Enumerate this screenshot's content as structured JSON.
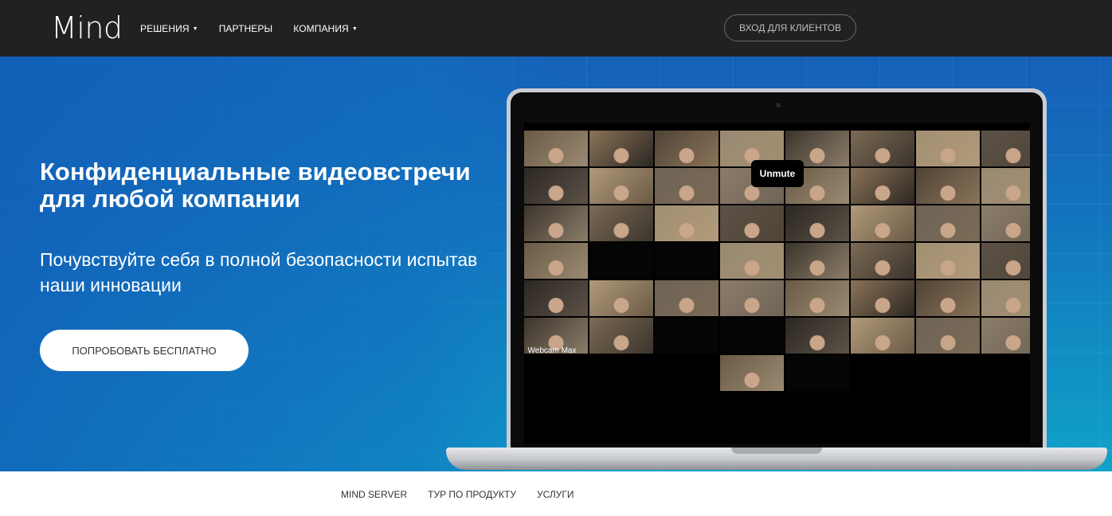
{
  "header": {
    "logo": "Mind",
    "nav": [
      {
        "label": "РЕШЕНИЯ",
        "dropdown": true
      },
      {
        "label": "ПАРТНЕРЫ",
        "dropdown": false
      },
      {
        "label": "КОМПАНИЯ",
        "dropdown": true
      }
    ],
    "login_label": "ВХОД ДЛЯ КЛИЕНТОВ"
  },
  "hero": {
    "headline_bold": "Конфиденциальные",
    "headline_rest": " видеовстречи для любой компании",
    "subline": "Почувствуйте себя в полной безопасности испытав наши инновации",
    "cta_label": "ПОПРОБОВАТЬ БЕСПЛАТНО"
  },
  "video_call": {
    "unmute_label": "Unmute",
    "webcam_label": "Webcam Max"
  },
  "subnav": {
    "links": [
      "MIND SERVER",
      "ТУР ПО ПРОДУКТУ",
      "УСЛУГИ"
    ]
  },
  "colors": {
    "topbar": "#212121",
    "hero_top": "#1660b8",
    "hero_bottom": "#10a3c9",
    "cta_bg": "#ffffff"
  }
}
